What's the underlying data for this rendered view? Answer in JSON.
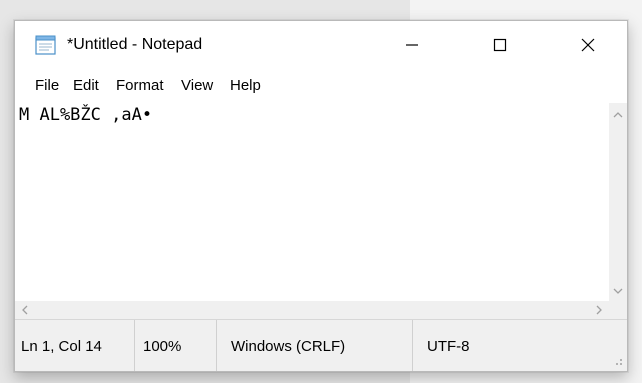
{
  "window": {
    "title": "*Untitled - Notepad"
  },
  "menu": {
    "items": [
      "File",
      "Edit",
      "Format",
      "View",
      "Help"
    ]
  },
  "editor": {
    "content": "M AL%BŽC ,aA•"
  },
  "statusbar": {
    "position": "Ln 1, Col 14",
    "zoom": "100%",
    "line_ending": "Windows (CRLF)",
    "encoding": "UTF-8"
  },
  "icons": {
    "app": "notepad-icon",
    "minimize": "minimize-icon",
    "maximize": "maximize-icon",
    "close": "close-icon",
    "scroll_up": "chevron-up-icon",
    "scroll_down": "chevron-down-icon",
    "scroll_left": "chevron-left-icon",
    "scroll_right": "chevron-right-icon",
    "resize": "resize-grip-icon"
  },
  "colors": {
    "window_bg": "#ffffff",
    "chrome_bg": "#f0f0f0",
    "text": "#000000"
  }
}
